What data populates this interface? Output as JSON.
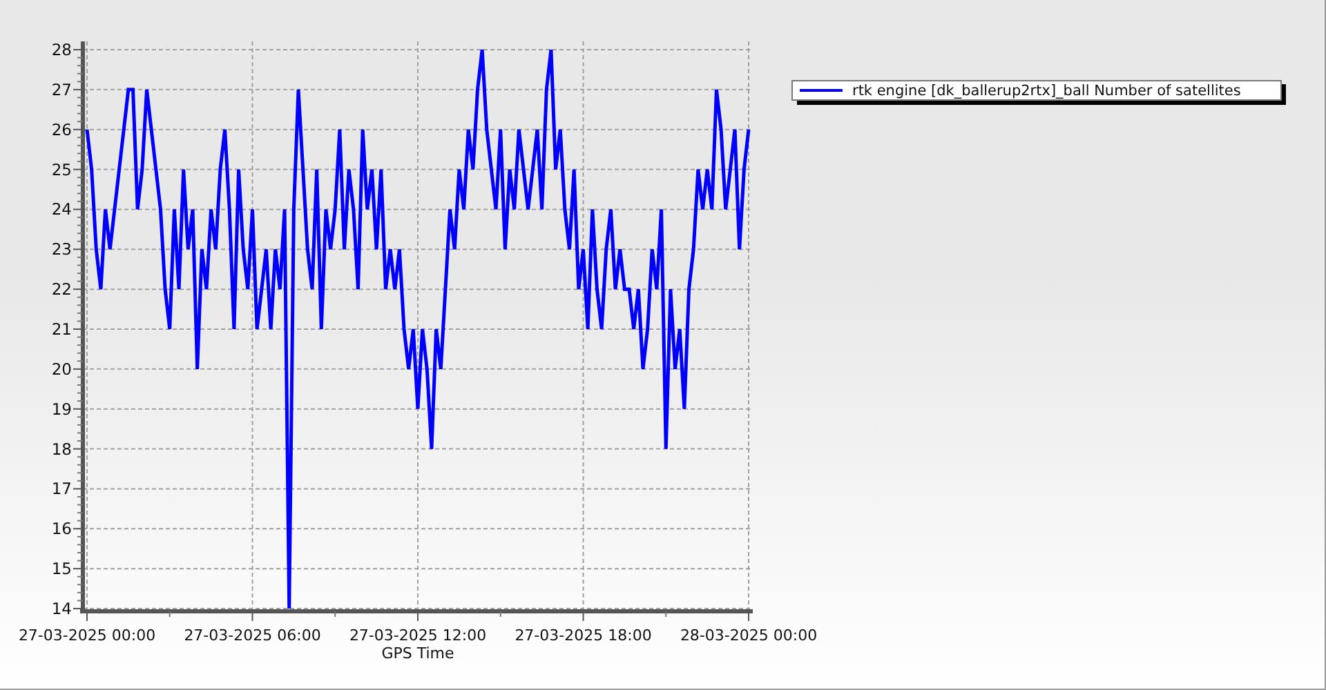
{
  "chart_data": {
    "type": "line",
    "xlabel": "GPS Time",
    "grid": true,
    "categories": [
      "27-03-2025 00:00",
      null,
      null,
      null,
      null,
      null,
      null,
      null,
      null,
      null,
      null,
      null,
      null,
      null,
      null,
      null,
      null,
      null,
      null,
      null,
      null,
      null,
      null,
      null,
      null,
      null,
      null,
      null,
      null,
      null,
      null,
      null,
      null,
      null,
      null,
      null,
      "27-03-2025 06:00",
      null,
      null,
      null,
      null,
      null,
      null,
      null,
      null,
      null,
      null,
      null,
      null,
      null,
      null,
      null,
      null,
      null,
      null,
      null,
      null,
      null,
      null,
      null,
      null,
      null,
      null,
      null,
      null,
      null,
      null,
      null,
      null,
      null,
      null,
      null,
      "27-03-2025 12:00",
      null,
      null,
      null,
      null,
      null,
      null,
      null,
      null,
      null,
      null,
      null,
      null,
      null,
      null,
      null,
      null,
      null,
      null,
      null,
      null,
      null,
      null,
      null,
      null,
      null,
      null,
      null,
      null,
      null,
      null,
      null,
      null,
      null,
      null,
      null,
      "27-03-2025 18:00",
      null,
      null,
      null,
      null,
      null,
      null,
      null,
      null,
      null,
      null,
      null,
      null,
      null,
      null,
      null,
      null,
      null,
      null,
      null,
      null,
      null,
      null,
      null,
      null,
      null,
      null,
      null,
      null,
      null,
      null,
      null,
      null,
      null,
      null,
      null,
      "28-03-2025 00:00"
    ],
    "ylim": [
      14,
      28
    ],
    "yticks": [
      14,
      15,
      16,
      17,
      18,
      19,
      20,
      21,
      22,
      23,
      24,
      25,
      26,
      27,
      28
    ],
    "series": [
      {
        "name": "rtk engine [dk_ballerup2rtx]_ball Number of satellites",
        "color": "#0000ff",
        "values": [
          26,
          25,
          23,
          22,
          24,
          23,
          24,
          25,
          26,
          27,
          27,
          24,
          25,
          27,
          26,
          25,
          24,
          22,
          21,
          24,
          22,
          25,
          23,
          24,
          20,
          23,
          22,
          24,
          23,
          25,
          26,
          24,
          21,
          25,
          23,
          22,
          24,
          21,
          22,
          23,
          21,
          23,
          22,
          24,
          14,
          24,
          27,
          25,
          23,
          22,
          25,
          21,
          24,
          23,
          24,
          26,
          23,
          25,
          24,
          22,
          26,
          24,
          25,
          23,
          25,
          22,
          23,
          22,
          23,
          21,
          20,
          21,
          19,
          21,
          20,
          18,
          21,
          20,
          22,
          24,
          23,
          25,
          24,
          26,
          25,
          27,
          28,
          26,
          25,
          24,
          26,
          23,
          25,
          24,
          26,
          25,
          24,
          25,
          26,
          24,
          27,
          28,
          25,
          26,
          24,
          23,
          25,
          22,
          23,
          21,
          24,
          22,
          21,
          23,
          24,
          22,
          23,
          22,
          22,
          21,
          22,
          20,
          21,
          23,
          22,
          24,
          18,
          22,
          20,
          21,
          19,
          22,
          23,
          25,
          24,
          25,
          24,
          27,
          26,
          24,
          25,
          26,
          23,
          25,
          26
        ]
      }
    ]
  }
}
